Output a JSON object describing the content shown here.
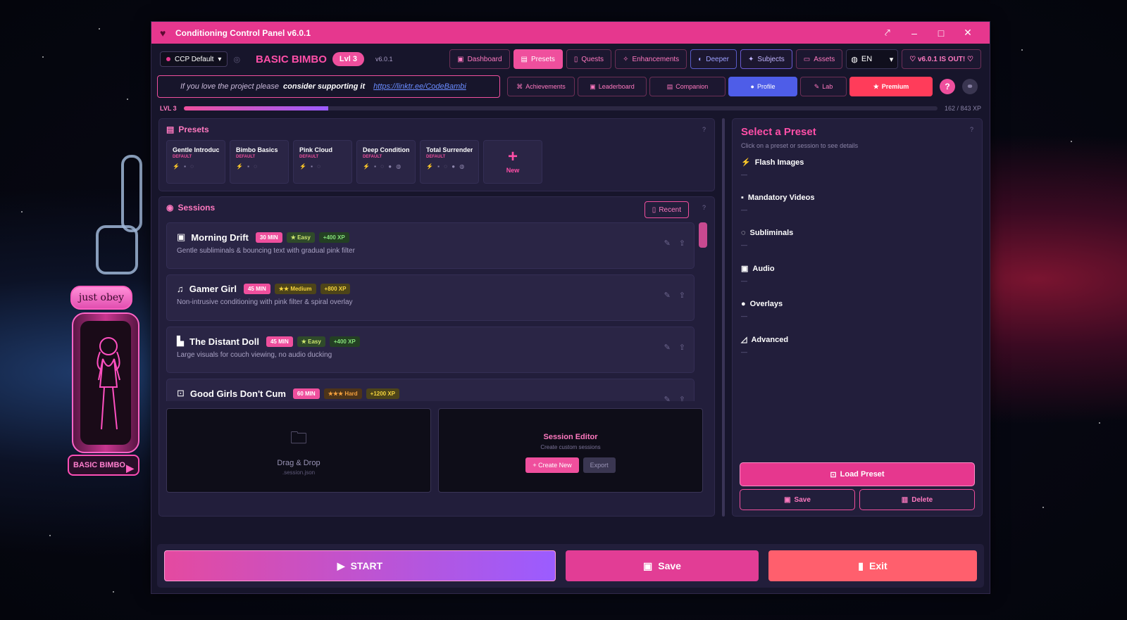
{
  "window": {
    "title": "Conditioning Control Panel v6.0.1"
  },
  "header": {
    "preset_select": "CCP Default",
    "brand": "BASIC BIMBO",
    "level_badge": "Lvl 3",
    "version": "v6.0.1",
    "nav": [
      {
        "label": "Dashboard",
        "icon": "dashboard-icon"
      },
      {
        "label": "Presets",
        "icon": "presets-icon"
      },
      {
        "label": "Quests",
        "icon": "quests-icon"
      },
      {
        "label": "Enhancements",
        "icon": "enhancements-icon"
      },
      {
        "label": "Deeper",
        "icon": "deeper-icon"
      },
      {
        "label": "Subjects",
        "icon": "subjects-icon"
      },
      {
        "label": "Assets",
        "icon": "folder-icon"
      }
    ],
    "language": "EN",
    "new_version": "v6.0.1 IS OUT!"
  },
  "support": {
    "text_a": "If you love the project please",
    "text_b": "consider supporting it",
    "link": "https://linktr.ee/CodeBambi"
  },
  "tabs2": [
    {
      "label": "Achievements"
    },
    {
      "label": "Leaderboard"
    },
    {
      "label": "Companion"
    },
    {
      "label": "Profile"
    },
    {
      "label": "Lab"
    },
    {
      "label": "Premium"
    }
  ],
  "xp": {
    "level": "LVL 3",
    "text": "162 / 843 XP",
    "progress": 0.192
  },
  "presets": {
    "title": "Presets",
    "cards": [
      {
        "name": "Gentle Introduc...",
        "tag": "DEFAULT",
        "icons": "⚡ ▪ ◌"
      },
      {
        "name": "Bimbo Basics",
        "tag": "DEFAULT",
        "icons": "⚡ ▪ ◌"
      },
      {
        "name": "Pink Cloud",
        "tag": "DEFAULT",
        "icons": "⚡ ▪ ◌"
      },
      {
        "name": "Deep Condition...",
        "tag": "DEFAULT",
        "icons": "⚡ ▪ ◌ ● ◍"
      },
      {
        "name": "Total Surrender",
        "tag": "DEFAULT",
        "icons": "⚡ ▪ ◌ ● ◍"
      }
    ],
    "new_label": "New"
  },
  "sessions": {
    "title": "Sessions",
    "recent_label": "Recent",
    "items": [
      {
        "name": "Morning Drift",
        "duration": "30 MIN",
        "difficulty": "★ Easy",
        "xp": "+400 XP",
        "desc": "Gentle subliminals & bouncing text with gradual pink filter"
      },
      {
        "name": "Gamer Girl",
        "duration": "45 MIN",
        "difficulty": "★★ Medium",
        "xp": "+800 XP",
        "desc": "Non-intrusive conditioning with pink filter & spiral overlay"
      },
      {
        "name": "The Distant Doll",
        "duration": "45 MIN",
        "difficulty": "★ Easy",
        "xp": "+400 XP",
        "desc": "Large visuals for couch viewing, no audio ducking"
      },
      {
        "name": "Good Girls Don't Cum",
        "duration": "60 MIN",
        "difficulty": "★★★ Hard",
        "xp": "+1200 XP",
        "desc": ""
      }
    ]
  },
  "dropzone": {
    "title": "Drag & Drop",
    "sub": ".session.json"
  },
  "editor": {
    "title": "Session Editor",
    "sub": "Create custom sessions",
    "create": "+ Create New",
    "export": "Export"
  },
  "details": {
    "title": "Select a Preset",
    "sub": "Click on a preset or session to see details",
    "categories": [
      {
        "name": "Flash Images",
        "value": "—"
      },
      {
        "name": "Mandatory Videos",
        "value": "—"
      },
      {
        "name": "Subliminals",
        "value": "—"
      },
      {
        "name": "Audio",
        "value": "—"
      },
      {
        "name": "Overlays",
        "value": "—"
      },
      {
        "name": "Advanced",
        "value": "—"
      }
    ],
    "load": "Load Preset",
    "save": "Save",
    "delete": "Delete"
  },
  "bottom": {
    "start": "START",
    "save": "Save",
    "exit": "Exit"
  },
  "mascot": {
    "obey": "just obey",
    "tag": "BASIC BIMBO"
  },
  "colors": {
    "accent": "#e6378e",
    "profile": "#4e5de8",
    "premium": "#ff3c5a",
    "exit": "#ff5f6d"
  }
}
